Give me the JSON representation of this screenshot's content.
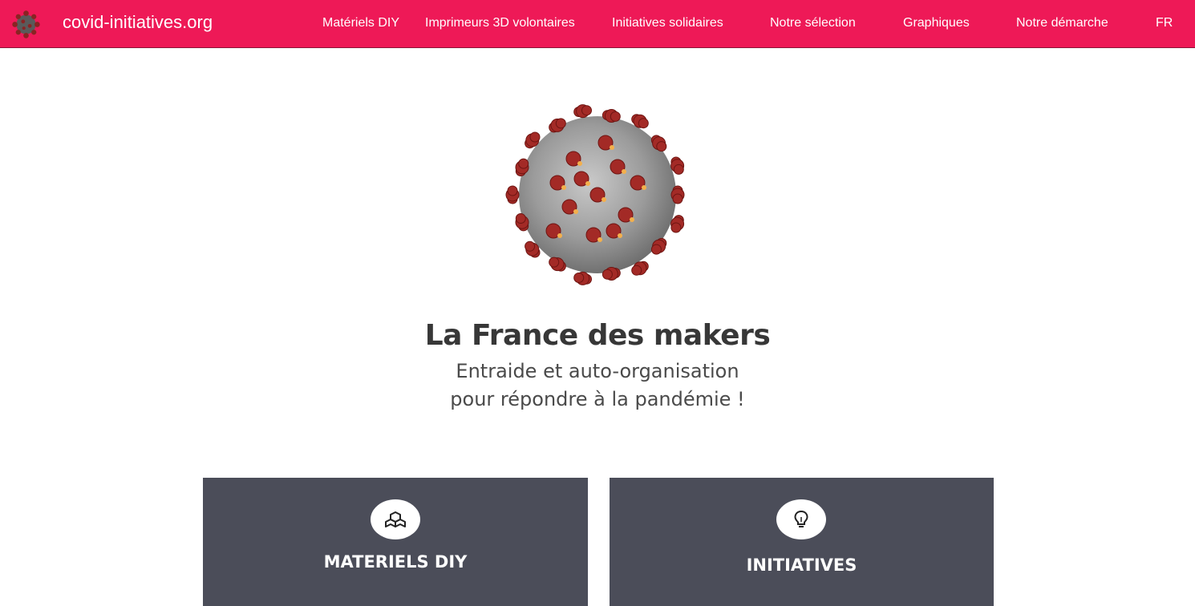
{
  "site": {
    "brand": "covid-initiatives.org"
  },
  "nav": {
    "items": [
      "Matériels DIY",
      "Imprimeurs 3D volontaires",
      "Initiatives solidaires",
      "Notre sélection",
      "Graphiques",
      "Notre démarche",
      "FR"
    ]
  },
  "hero": {
    "title": "La France des makers",
    "subtitle_line1": "Entraide et auto-organisation",
    "subtitle_line2": "pour répondre à la pandémie !"
  },
  "cards": [
    {
      "title": "MATERIELS DIY",
      "icon": "cubes-icon"
    },
    {
      "title": "INITIATIVES",
      "icon": "lightbulb-icon"
    }
  ],
  "colors": {
    "brand": "#ee1957",
    "card_bg": "#4b4d59",
    "text_dark": "#373737",
    "virus_spike": "#a32a26",
    "virus_body": "#9a9a9a"
  }
}
